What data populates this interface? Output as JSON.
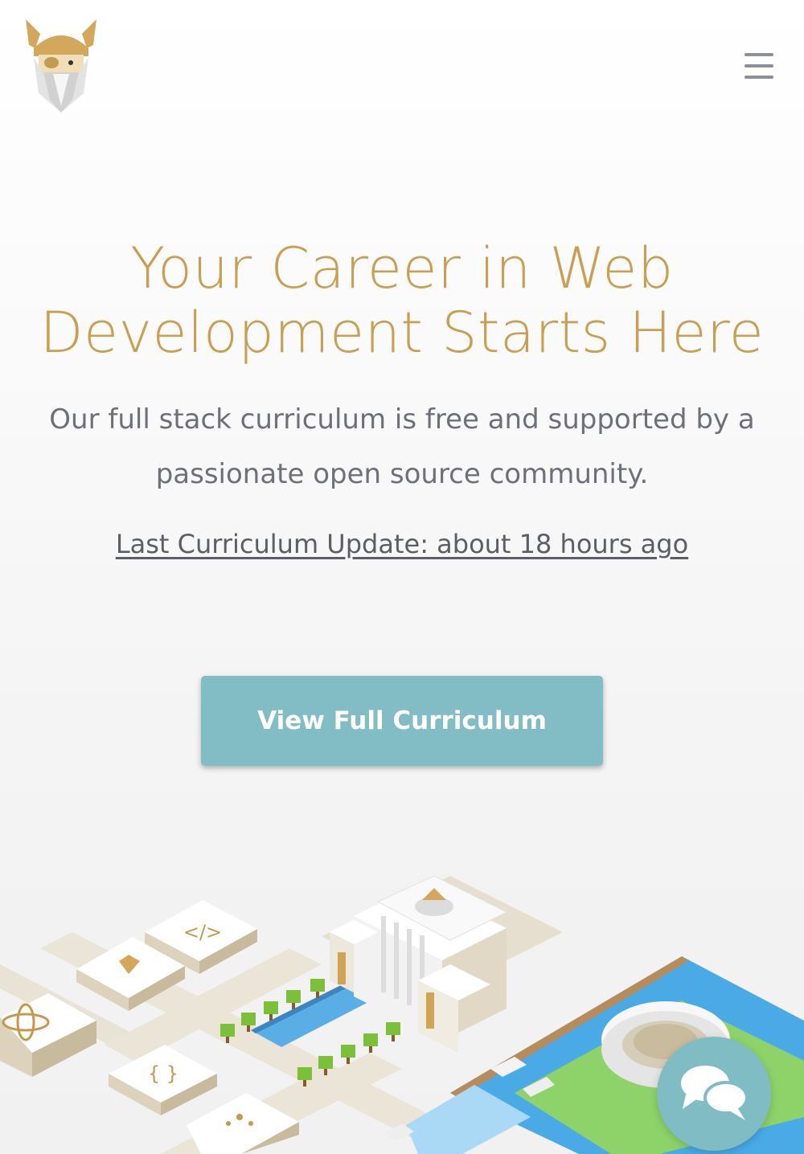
{
  "header": {
    "logo_icon": "viking-logo-icon",
    "menu_icon": "hamburger-menu-icon"
  },
  "hero": {
    "title_line1": "Your Career in Web",
    "title_line2": "Development Starts Here",
    "subtitle_line1": "Our full stack curriculum is free and supported by a",
    "subtitle_line2": "passionate open source community.",
    "update_link": "Last Curriculum Update: about 18 hours ago",
    "cta_label": "View Full Curriculum"
  },
  "illustration": {
    "name": "isometric-campus-illustration",
    "code_tag_text": "</>"
  },
  "chat": {
    "icon": "chat-bubbles-icon"
  },
  "colors": {
    "title_gold": "#c9a052",
    "text_gray": "#6e7079",
    "cta_teal": "#82bcc4",
    "chat_teal": "#80bcc4"
  }
}
